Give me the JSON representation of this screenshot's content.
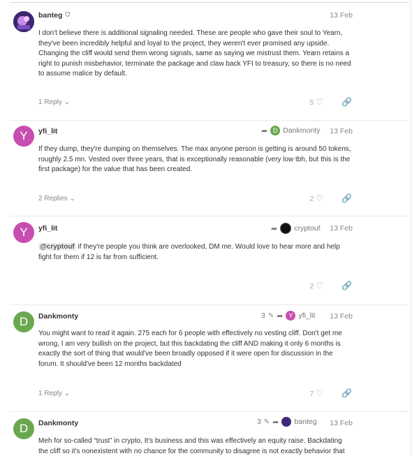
{
  "posts": [
    {
      "username": "banteg",
      "avatar_letter": "",
      "avatar_color": "#3f2a78",
      "date": "13 Feb",
      "body": [
        "I don't believe there is additional signaling needed. These are people who gave their soul to Yearn, they've been incredibly helpful and loyal to the project, they weren't ever promised any upside. Changing the cliff would send them wrong signals, same as saying we mistrust them. Yearn retains a right to punish misbehavior, terminate the package and claw back YFI to treasury, so there is no need to assume malice by default."
      ],
      "replies": "1 Reply",
      "likes": "5"
    },
    {
      "username": "yfi_lit",
      "avatar_letter": "Y",
      "avatar_color": "#c74eb0",
      "reply_to": "Dankmonty",
      "reply_to_letter": "D",
      "reply_to_color": "#6aa84f",
      "date": "13 Feb",
      "body": [
        "If they dump, they're dumping on themselves. The max anyone person is getting is around 50 tokens, roughly 2.5 mn. Vested over three years, that is exceptionally reasonable (very low tbh, but this is the first package) for the value that has been created."
      ],
      "replies": "2 Replies",
      "likes": "2"
    },
    {
      "username": "yfi_lit",
      "avatar_letter": "Y",
      "avatar_color": "#c74eb0",
      "reply_to": "cryptouf",
      "date": "13 Feb",
      "mention": "@cryptouf",
      "body_after_mention": " if they're people you think are overlooked, DM me. Would love to hear more and help fight for them if 12 is far from sufficient.",
      "likes": "2"
    },
    {
      "username": "Dankmonty",
      "avatar_letter": "D",
      "avatar_color": "#6aa84f",
      "edits": "3",
      "reply_to": "yfi_lit",
      "reply_to_letter": "Y",
      "reply_to_color": "#c74eb0",
      "date": "13 Feb",
      "body": [
        "You might want to read it again. 275 each for 6 people with effectively no vesting cliff. Don't get me wrong, I am very bullish on the project, but this backdating the cliff AND making it only 6 months is exactly the sort of thing that would've been broadly opposed if it were open for discussion in the forum. It should've been 12 months backdated"
      ],
      "replies": "1 Reply",
      "likes": "7"
    },
    {
      "username": "Dankmonty",
      "avatar_letter": "D",
      "avatar_color": "#6aa84f",
      "edits": "3",
      "reply_to": "banteg",
      "date": "13 Feb",
      "body": [
        "Meh for so-called “trust” in crypto. It's business and this was effectively an equity raise. Backdating the cliff so it's nonexistent with no chance for the community to disagree is not exactly behavior that inspires"
      ]
    }
  ]
}
